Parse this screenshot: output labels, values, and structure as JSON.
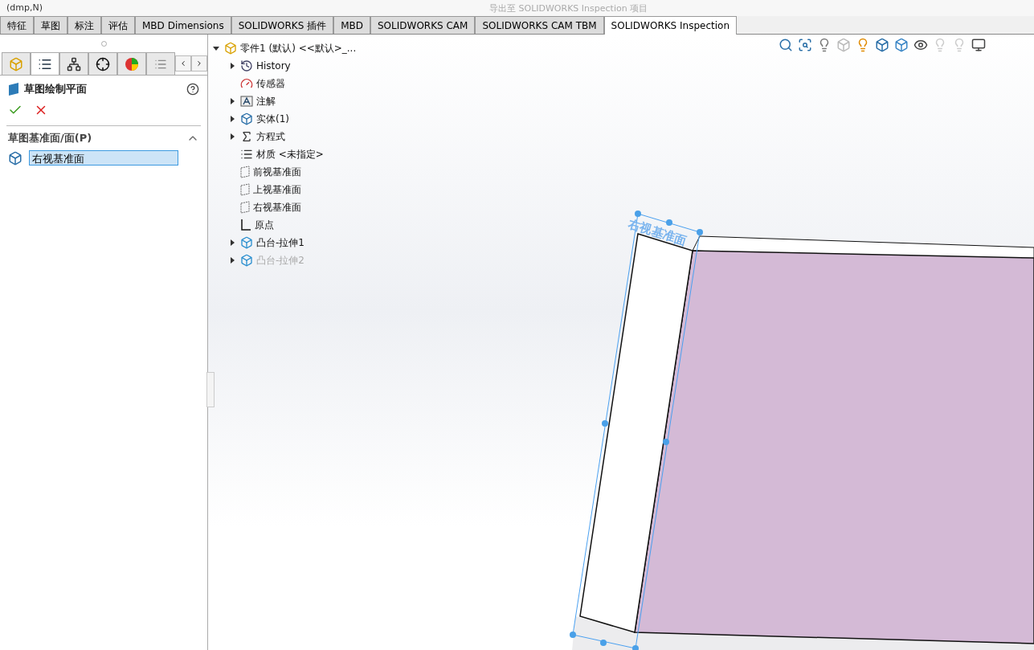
{
  "top_strip": {
    "left_text": "(dmp,N)",
    "command": "导出至 SOLIDWORKS Inspection 项目"
  },
  "ribbon_tabs": [
    {
      "label": "特征",
      "selected": false
    },
    {
      "label": "草图",
      "selected": false
    },
    {
      "label": "标注",
      "selected": false
    },
    {
      "label": "评估",
      "selected": false
    },
    {
      "label": "MBD Dimensions",
      "selected": false
    },
    {
      "label": "SOLIDWORKS 插件",
      "selected": false
    },
    {
      "label": "MBD",
      "selected": false
    },
    {
      "label": "SOLIDWORKS CAM",
      "selected": false
    },
    {
      "label": "SOLIDWORKS CAM TBM",
      "selected": false
    },
    {
      "label": "SOLIDWORKS Inspection",
      "selected": true
    }
  ],
  "panel_tabs": [
    {
      "kind": "feature",
      "selected": false
    },
    {
      "kind": "property",
      "selected": true
    },
    {
      "kind": "config",
      "selected": false
    },
    {
      "kind": "dim",
      "selected": false
    },
    {
      "kind": "display",
      "selected": false
    },
    {
      "kind": "more",
      "selected": false
    }
  ],
  "property_manager": {
    "title": "草图绘制平面",
    "section": {
      "title": "草图基准面/面(P)",
      "expanded": true,
      "value": "右视基准面"
    }
  },
  "tree": {
    "label": "零件1 (默认) <<默认>_...",
    "expanded": true,
    "children": [
      {
        "label": "History",
        "kind": "history",
        "expandable": true,
        "disabled": false
      },
      {
        "label": "传感器",
        "kind": "sensor",
        "expandable": false,
        "disabled": false
      },
      {
        "label": "注解",
        "kind": "annotation",
        "expandable": true,
        "disabled": false
      },
      {
        "label": "实体(1)",
        "kind": "solid",
        "expandable": true,
        "disabled": false
      },
      {
        "label": "方程式",
        "kind": "equation",
        "expandable": true,
        "disabled": false
      },
      {
        "label": "材质 <未指定>",
        "kind": "material",
        "expandable": false,
        "disabled": false
      },
      {
        "label": "前视基准面",
        "kind": "plane",
        "expandable": false,
        "disabled": false
      },
      {
        "label": "上视基准面",
        "kind": "plane",
        "expandable": false,
        "disabled": false
      },
      {
        "label": "右视基准面",
        "kind": "plane",
        "expandable": false,
        "disabled": false
      },
      {
        "label": "原点",
        "kind": "origin",
        "expandable": false,
        "disabled": false
      },
      {
        "label": "凸台-拉伸1",
        "kind": "feature",
        "expandable": true,
        "disabled": false
      },
      {
        "label": "凸台-拉伸2",
        "kind": "feature",
        "expandable": true,
        "disabled": true
      }
    ]
  },
  "viewport": {
    "plane_label": "右视基准面"
  }
}
